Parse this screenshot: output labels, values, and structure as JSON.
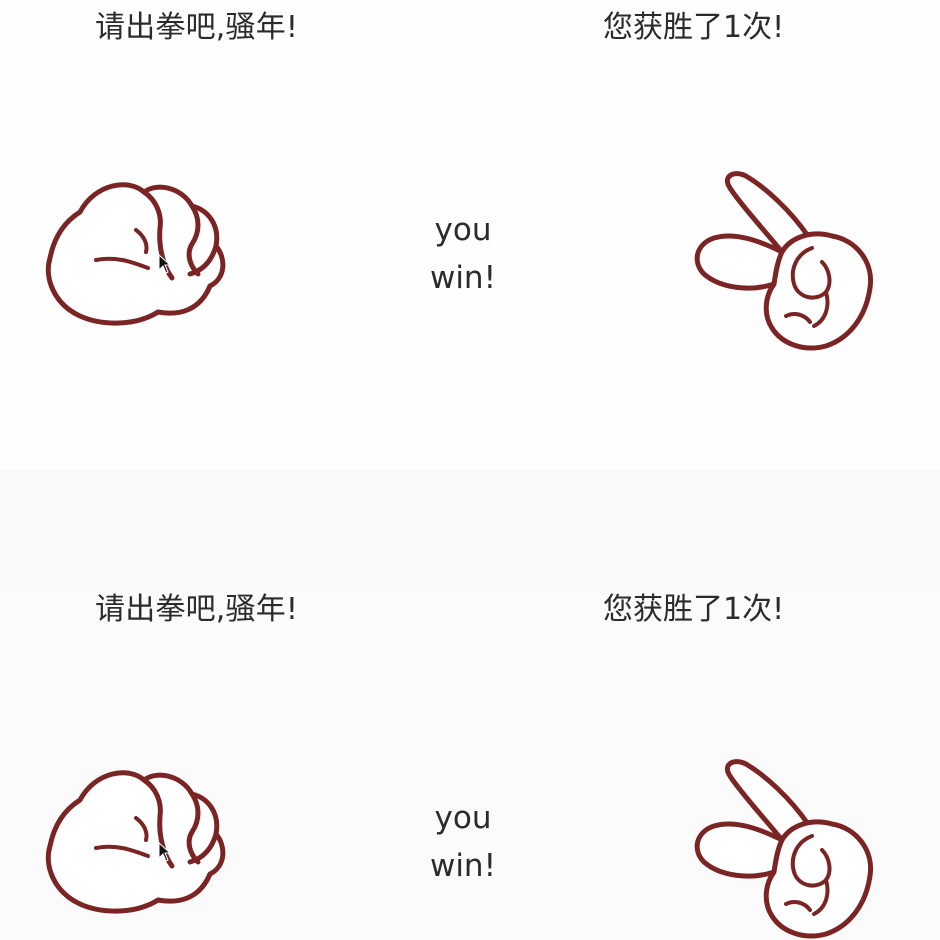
{
  "rounds": [
    {
      "prompt": "请出拳吧,骚年!",
      "score": "您获胜了1次!",
      "result_line1": "you",
      "result_line2": "win!",
      "player_hand": "rock-fist-icon",
      "computer_hand": "scissors-hand-icon"
    },
    {
      "prompt": "请出拳吧,骚年!",
      "score": "您获胜了1次!",
      "result_line1": "you",
      "result_line2": "win!",
      "player_hand": "rock-fist-icon",
      "computer_hand": "scissors-hand-icon"
    }
  ],
  "colors": {
    "hand_outline": "#7a2424",
    "hand_fill": "#ffffff",
    "text": "#2b2b2b"
  }
}
